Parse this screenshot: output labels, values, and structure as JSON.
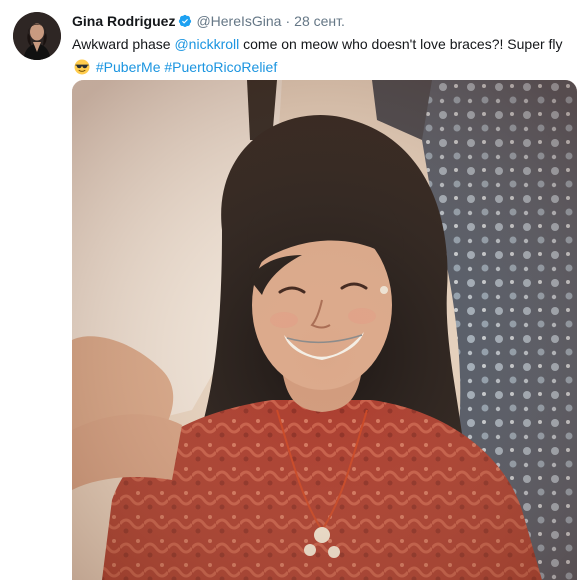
{
  "tweet": {
    "author_name": "Gina Rodriguez",
    "handle": "@HereIsGina",
    "separator": "·",
    "timestamp": "28 сент.",
    "verified": true,
    "text_segments": {
      "part1": "Awkward phase ",
      "mention": "@nickkroll",
      "part2": " come on meow who doesn't love braces?! Super fly ",
      "emoji": "😎",
      "space": " ",
      "hashtag1": "#PuberMe",
      "hashtag2": "#PuertoRicoRelief"
    },
    "media": {
      "type": "photo"
    }
  },
  "colors": {
    "link": "#1b95e0",
    "secondary_text": "#657786",
    "primary_text": "#14171a",
    "verified_badge": "#1da1f2"
  },
  "icons": {
    "verified": "verified-badge-icon",
    "emoji": "sunglasses-emoji-icon"
  }
}
